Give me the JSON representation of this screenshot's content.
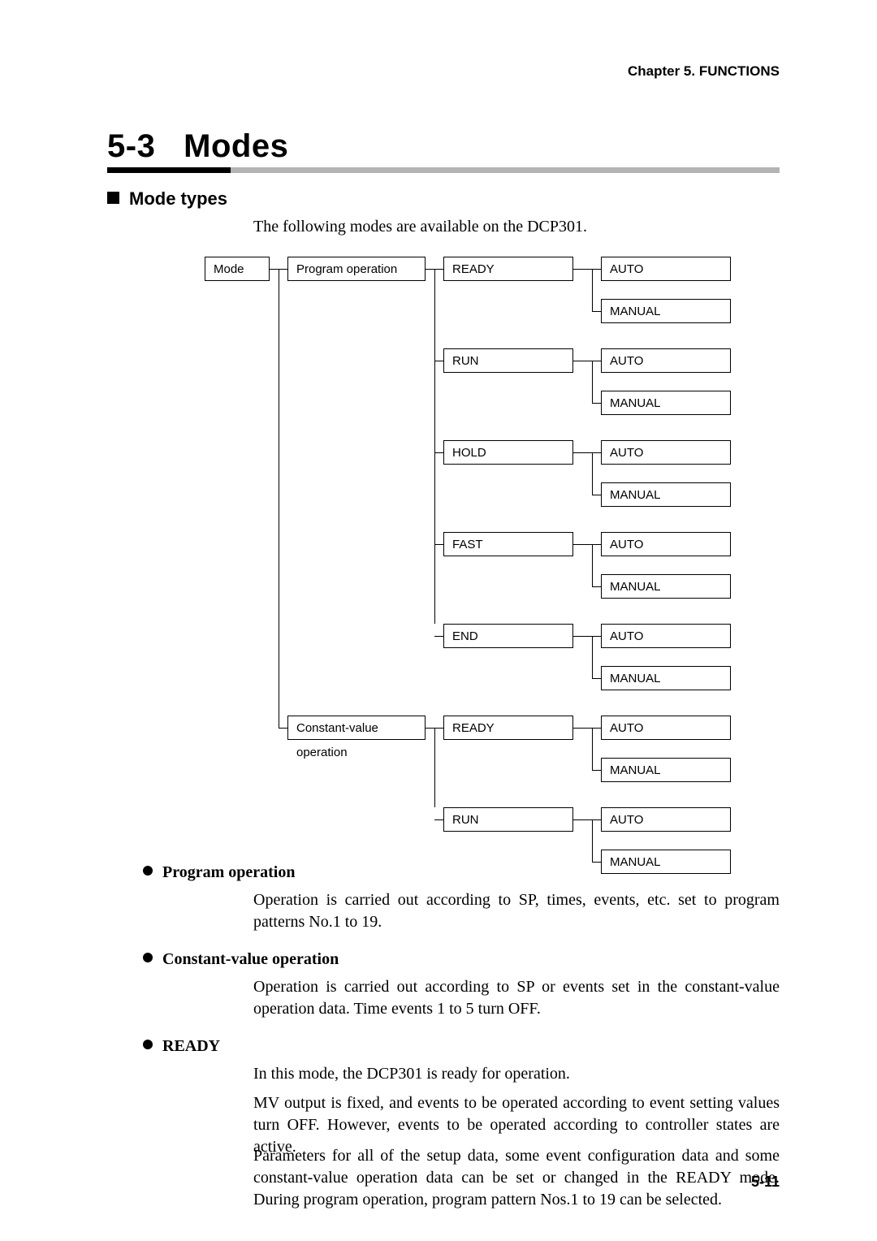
{
  "header": {
    "chapter": "Chapter 5. FUNCTIONS"
  },
  "section": {
    "number": "5-3",
    "title": "Modes"
  },
  "mode_types": {
    "heading": "Mode types",
    "intro": "The following modes are available on the DCP301."
  },
  "diagram": {
    "root": "Mode",
    "ops": [
      {
        "label": "Program operation",
        "states": [
          "READY",
          "RUN",
          "HOLD",
          "FAST",
          "END"
        ]
      },
      {
        "label": "Constant-value operation",
        "states": [
          "READY",
          "RUN"
        ]
      }
    ],
    "leaf": {
      "auto": "AUTO",
      "manual": "MANUAL"
    }
  },
  "body": {
    "prog_op": {
      "title": "Program operation",
      "text": "Operation is carried out according to SP, times, events, etc. set to program patterns No.1 to 19."
    },
    "const_op": {
      "title": "Constant-value operation",
      "text": "Operation is carried out according to SP or events set in the constant-value operation data. Time events 1 to 5 turn OFF."
    },
    "ready": {
      "title": "READY",
      "p1": "In this mode, the DCP301 is ready for operation.",
      "p2": "MV output is fixed, and events to be operated according to event setting values turn OFF. However, events to be operated according to controller states are active.",
      "p3": "Parameters for all of the setup data, some event configuration data and some constant-value operation data can be set or changed in the READY mode. During program operation, program pattern Nos.1 to 19 can be selected."
    }
  },
  "footer": {
    "page": "5-11"
  }
}
